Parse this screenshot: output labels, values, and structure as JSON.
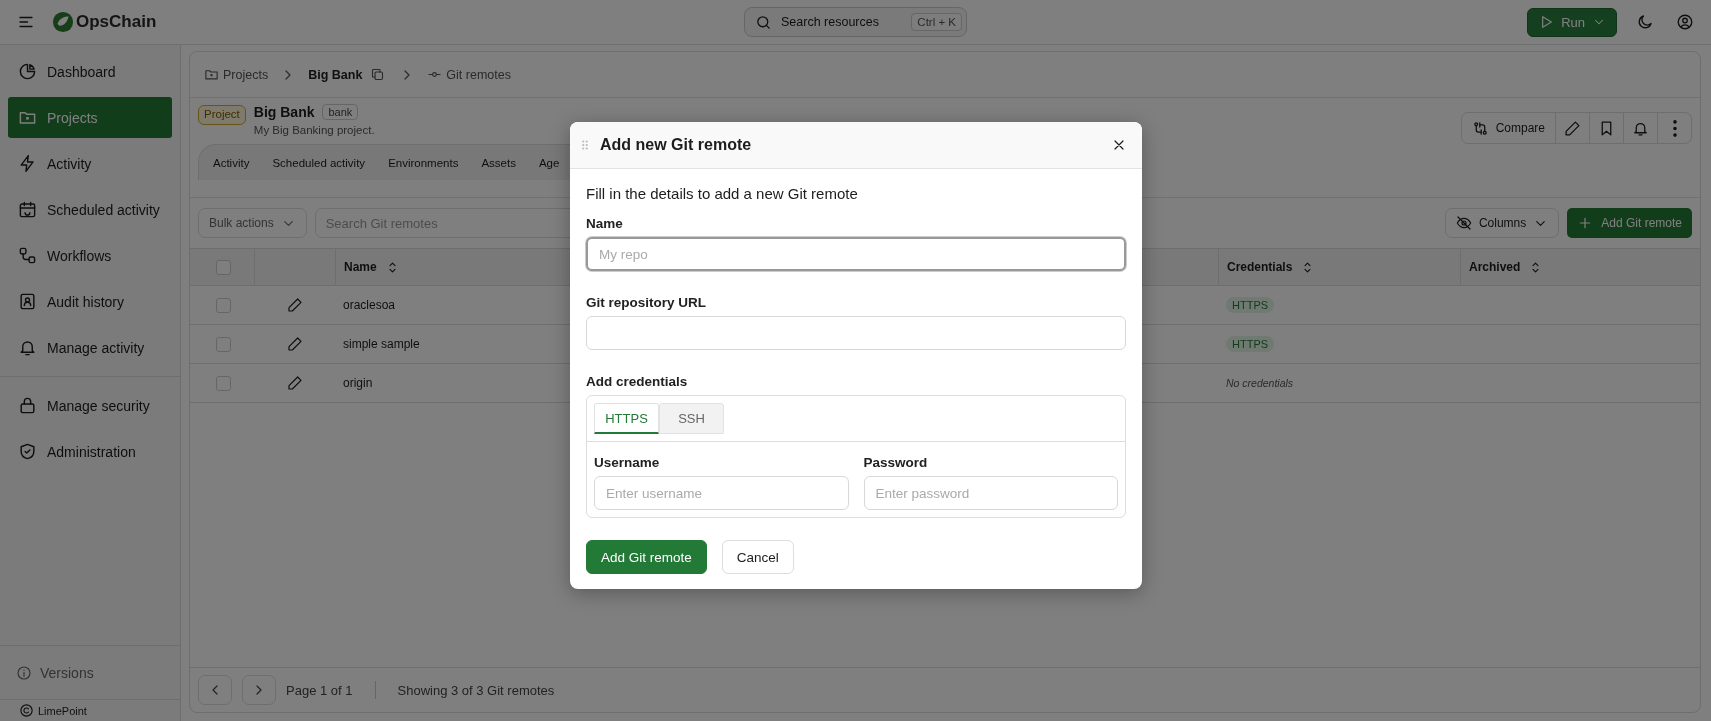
{
  "top_bar": {
    "logo_text": "OpsChain",
    "search": {
      "placeholder": "Search resources",
      "shortcut": "Ctrl + K"
    },
    "run_button": "Run"
  },
  "sidebar": {
    "groups": [
      [
        {
          "label": "Dashboard",
          "selected": false
        },
        {
          "label": "Projects",
          "selected": true
        },
        {
          "label": "Activity",
          "selected": false
        },
        {
          "label": "Scheduled activity",
          "selected": false
        },
        {
          "label": "Workflows",
          "selected": false
        },
        {
          "label": "Audit history",
          "selected": false
        },
        {
          "label": "Manage activity",
          "selected": false
        }
      ],
      [
        {
          "label": "Manage security",
          "selected": false
        },
        {
          "label": "Administration",
          "selected": false
        }
      ]
    ],
    "versions": "Versions",
    "copyright": "LimePoint"
  },
  "breadcrumbs": [
    "Projects",
    "Big Bank",
    "Git remotes"
  ],
  "project": {
    "badge": "Project",
    "name": "Big Bank",
    "tag": "bank",
    "description": "My Big Banking project.",
    "compare_button": "Compare"
  },
  "tabs": [
    "Activity",
    "Scheduled activity",
    "Environments",
    "Assets",
    "Age"
  ],
  "toolbar": {
    "bulk_actions": "Bulk actions",
    "search_placeholder": "Search Git remotes",
    "columns_button": "Columns",
    "add_button": "Add Git remote"
  },
  "table": {
    "all_checked": false,
    "columns": [
      "Name",
      "Credentials",
      "Archived"
    ],
    "rows": [
      {
        "checked": false,
        "name": "oraclesoa",
        "credentials": "HTTPS",
        "kind": "tag"
      },
      {
        "checked": false,
        "name": "simple sample",
        "credentials": "HTTPS",
        "kind": "tag"
      },
      {
        "checked": false,
        "name": "origin",
        "credentials": "No credentials",
        "kind": "none"
      }
    ]
  },
  "pagination": {
    "page": "Page 1 of 1",
    "summary": "Showing 3 of 3 Git remotes"
  },
  "dialog": {
    "title": "Add new Git remote",
    "intro": "Fill in the details to add a new Git remote",
    "fields": [
      {
        "label": "Name",
        "placeholder": "My repo",
        "focused": true
      },
      {
        "label": "Git repository URL",
        "focused": false
      }
    ],
    "credentials_label": "Add credentials",
    "credential_tabs": [
      {
        "label": "HTTPS",
        "selected": true
      },
      {
        "label": "SSH",
        "selected": false
      }
    ],
    "credential_fields": [
      {
        "label": "Username",
        "placeholder": "Enter username"
      },
      {
        "label": "Password",
        "placeholder": "Enter password"
      }
    ],
    "buttons": [
      {
        "label": "Add Git remote",
        "kind": "primary"
      },
      {
        "label": "Cancel",
        "kind": "secondary"
      }
    ]
  }
}
